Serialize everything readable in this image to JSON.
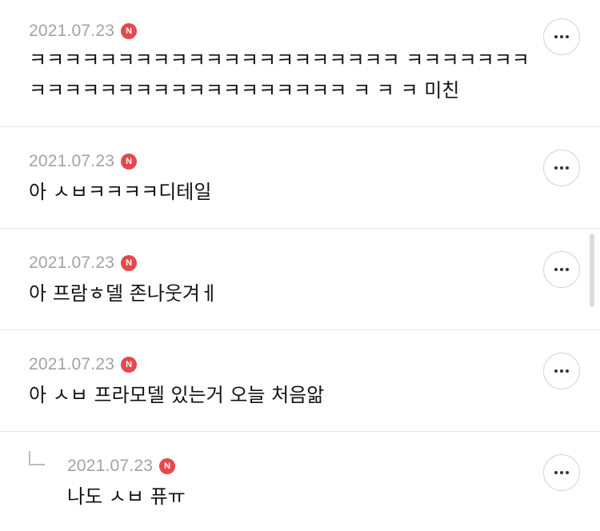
{
  "comments": [
    {
      "date": "2021.07.23",
      "badge": "N",
      "text": "ㅋㅋㅋㅋㅋㅋㅋㅋㅋㅋㅋㅋㅋㅋㅋㅋㅋㅋㅋㅋㅋ ㅋㅋㅋㅋㅋㅋㅋㅋㅋㅋㅋㅋㅋㅋㅋㅋㅋㅋㅋㅋㅋㅋㅋㅋㅋ ㅋ ㅋ ㅋ 미친"
    },
    {
      "date": "2021.07.23",
      "badge": "N",
      "text": "아 ㅅㅂㅋㅋㅋㅋ디테일"
    },
    {
      "date": "2021.07.23",
      "badge": "N",
      "text": "아 프람ㅎ델 존나웃겨ㅔ"
    },
    {
      "date": "2021.07.23",
      "badge": "N",
      "text": "아 ㅅㅂ 프라모델 있는거 오늘 처음앎"
    },
    {
      "date": "2021.07.23",
      "badge": "N",
      "text": "나도 ㅅㅂ 퓨ㅠ",
      "is_reply": true
    }
  ],
  "more_icon": "more-horizontal-icon",
  "colors": {
    "badge": "#e5484d",
    "date": "#a3a3a3",
    "divider": "#e3e3e3"
  }
}
